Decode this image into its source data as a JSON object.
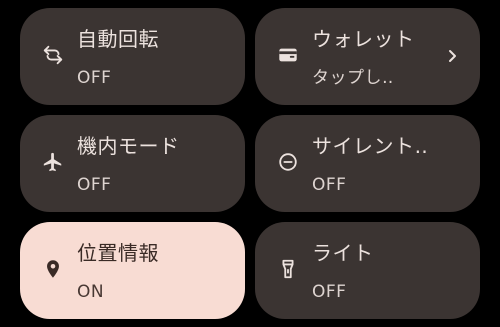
{
  "tiles": {
    "auto_rotate": {
      "title": "自動回転",
      "state": "OFF",
      "icon": "auto-rotate-icon"
    },
    "wallet": {
      "title": "ウォレット",
      "subtitle": "タップし‥",
      "icon": "wallet-icon",
      "chevron": "chevron-right-icon"
    },
    "airplane": {
      "title": "機内モード",
      "state": "OFF",
      "icon": "airplane-icon"
    },
    "silent": {
      "title": "サイレント‥",
      "state": "OFF",
      "icon": "do-not-disturb-icon"
    },
    "location": {
      "title": "位置情報",
      "state": "ON",
      "icon": "location-pin-icon"
    },
    "flashlight": {
      "title": "ライト",
      "state": "OFF",
      "icon": "flashlight-icon"
    }
  },
  "colors": {
    "background": "#000000",
    "tile_off": "#3b3432",
    "tile_on": "#f8dcd3",
    "text_off": "#ece2de",
    "text_on": "#3a2b26"
  }
}
